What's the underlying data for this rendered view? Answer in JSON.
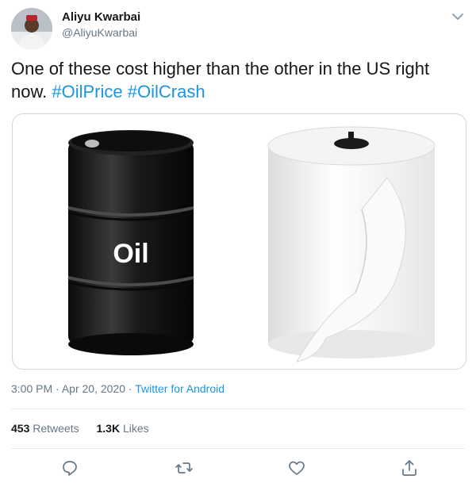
{
  "tweet": {
    "author_name": "Aliyu Kwarbai",
    "author_handle": "@AliyuKwarbai",
    "text_plain": "One of these cost higher than the other in the US right now. ",
    "hashtags": [
      "#OilPrice",
      "#OilCrash"
    ],
    "time": "3:00 PM",
    "date": "Apr 20, 2020",
    "dot": "·",
    "source": "Twitter for Android",
    "retweets_count": "453",
    "retweets_label": "Retweets",
    "likes_count": "1.3K",
    "likes_label": "Likes",
    "barrel_label": "Oil"
  },
  "colors": {
    "link": "#1b95e0",
    "secondary_text": "#657786",
    "border": "#ccd6dd"
  },
  "icons": {
    "menu": "chevron-down-icon",
    "reply": "reply-icon",
    "retweet": "retweet-icon",
    "like": "heart-icon",
    "share": "share-icon"
  }
}
